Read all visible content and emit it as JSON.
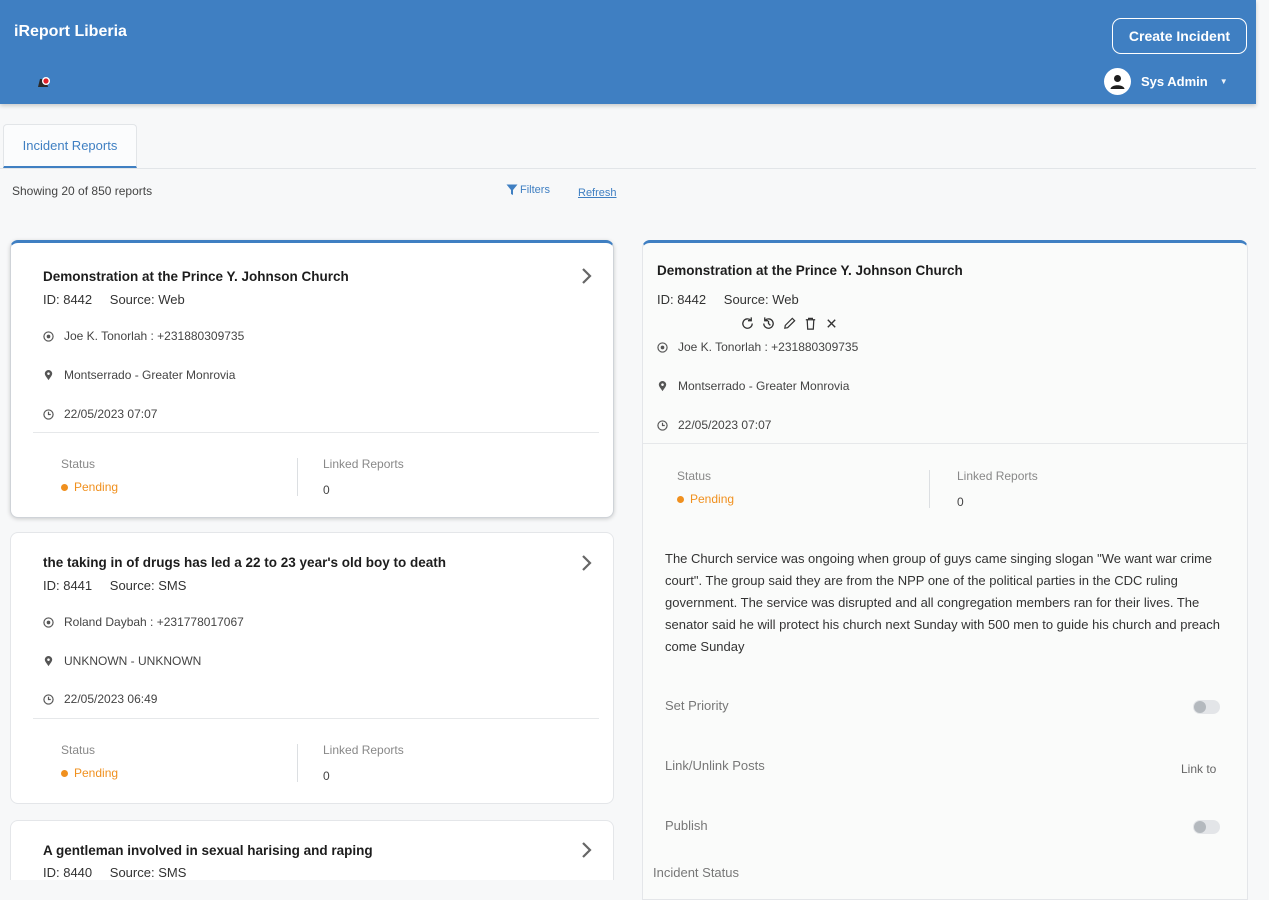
{
  "header": {
    "app_title": "iReport Liberia",
    "create_button": "Create Incident",
    "user_name": "Sys Admin",
    "accent_color": "#3f7fc2"
  },
  "tabs": [
    {
      "label": "Incident Reports"
    }
  ],
  "toolbar": {
    "showing": "Showing 20 of 850 reports",
    "filters": "Filters",
    "refresh": "Refresh"
  },
  "reports": [
    {
      "title": "Demonstration at the Prince Y. Johnson Church",
      "id": "ID: 8442",
      "source": "Source: Web",
      "reporter": "Joe K. Tonorlah : +231880309735",
      "location": "Montserrado - Greater Monrovia",
      "datetime": "22/05/2023 07:07",
      "status_label": "Status",
      "status": "Pending",
      "linked_label": "Linked Reports",
      "linked": "0"
    },
    {
      "title": "the taking in of drugs has led a 22 to 23 year's old boy to death",
      "id": "ID: 8441",
      "source": "Source: SMS",
      "reporter": "Roland Daybah : +231778017067",
      "location": "UNKNOWN - UNKNOWN",
      "datetime": "22/05/2023 06:49",
      "status_label": "Status",
      "status": "Pending",
      "linked_label": "Linked Reports",
      "linked": "0"
    },
    {
      "title": "A gentleman involved in sexual harising and raping",
      "id": "ID: 8440",
      "source": "Source: SMS"
    }
  ],
  "detail": {
    "title": "Demonstration at the Prince Y. Johnson Church",
    "id": "ID: 8442",
    "source": "Source: Web",
    "reporter": "Joe K. Tonorlah : +231880309735",
    "location": "Montserrado - Greater Monrovia",
    "datetime": "22/05/2023 07:07",
    "status_label": "Status",
    "status": "Pending",
    "linked_label": "Linked Reports",
    "linked": "0",
    "description": "The Church service was ongoing when group of guys came singing slogan \"We want war crime court\". The group said they are from the NPP one of the political parties in the CDC ruling government. The service was disrupted and all congregation members ran for their lives. The senator said he will protect his church next Sunday with 500 men to guide his church and preach come Sunday",
    "set_priority": "Set Priority",
    "link_posts": "Link/Unlink Posts",
    "link_to": "Link to",
    "publish": "Publish",
    "incident_status": "Incident Status",
    "status_color": "#f0901e"
  }
}
